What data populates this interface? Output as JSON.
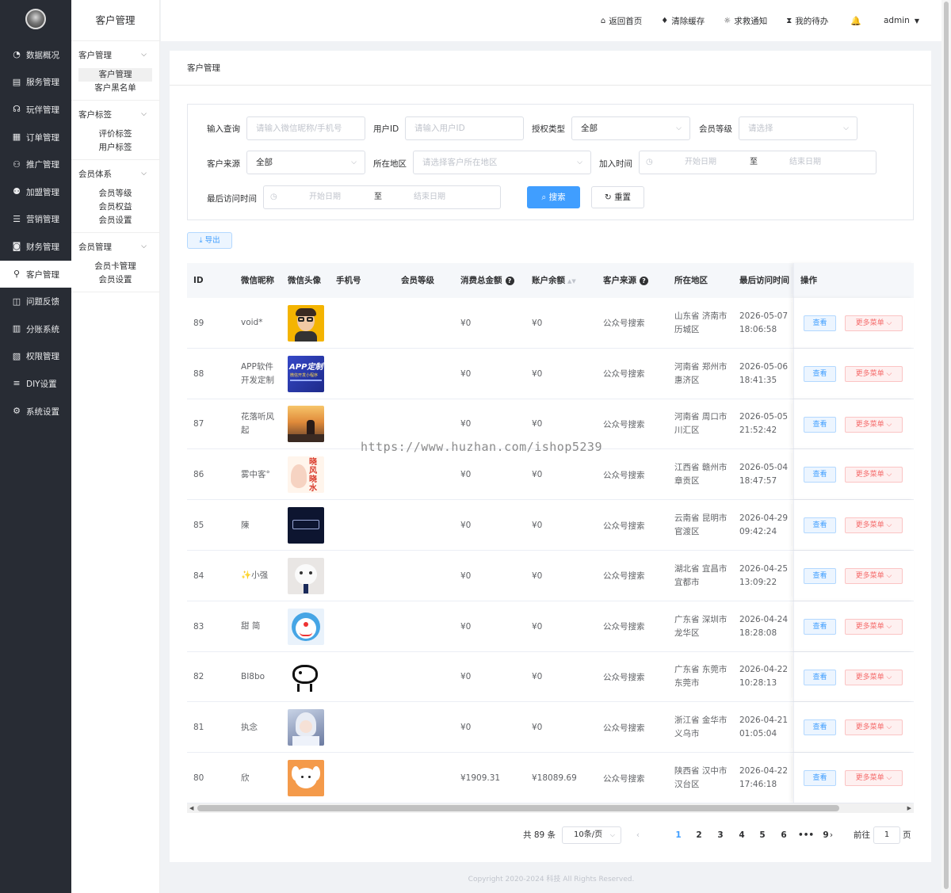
{
  "sidebar": {
    "items": [
      {
        "label": "数据概况",
        "icon": "dashboard-icon"
      },
      {
        "label": "服务管理",
        "icon": "service-icon"
      },
      {
        "label": "玩伴管理",
        "icon": "headset-icon"
      },
      {
        "label": "订单管理",
        "icon": "order-icon"
      },
      {
        "label": "推广管理",
        "icon": "promotion-icon"
      },
      {
        "label": "加盟管理",
        "icon": "franchise-icon"
      },
      {
        "label": "营销管理",
        "icon": "marketing-icon"
      },
      {
        "label": "财务管理",
        "icon": "finance-icon"
      },
      {
        "label": "客户管理",
        "icon": "customer-icon",
        "active": true
      },
      {
        "label": "问题反馈",
        "icon": "feedback-icon"
      },
      {
        "label": "分账系统",
        "icon": "split-icon"
      },
      {
        "label": "权限管理",
        "icon": "permission-icon"
      },
      {
        "label": "DIY设置",
        "icon": "diy-icon"
      },
      {
        "label": "系统设置",
        "icon": "settings-icon"
      }
    ]
  },
  "subsidebar": {
    "title": "客户管理",
    "groups": [
      {
        "label": "客户管理",
        "items": [
          "客户管理",
          "客户黑名单"
        ]
      },
      {
        "label": "客户标签",
        "items": [
          "评价标签",
          "用户标签"
        ]
      },
      {
        "label": "会员体系",
        "items": [
          "会员等级",
          "会员权益",
          "会员设置"
        ]
      },
      {
        "label": "会员管理",
        "items": [
          "会员卡管理",
          "会员设置"
        ]
      }
    ]
  },
  "topbar": {
    "home": "返回首页",
    "clear_cache": "清除缓存",
    "help": "求救通知",
    "todo": "我的待办",
    "user": "admin"
  },
  "page": {
    "title": "客户管理"
  },
  "filters": {
    "query_label": "输入查询",
    "query_placeholder": "请输入微信昵称/手机号",
    "uid_label": "用户ID",
    "uid_placeholder": "请输入用户ID",
    "auth_label": "授权类型",
    "auth_value": "全部",
    "level_label": "会员等级",
    "level_placeholder": "请选择",
    "source_label": "客户来源",
    "source_value": "全部",
    "region_label": "所在地区",
    "region_placeholder": "请选择客户所在地区",
    "join_label": "加入时间",
    "start_placeholder": "开始日期",
    "to": "至",
    "end_placeholder": "结束日期",
    "visit_label": "最后访问时间",
    "search": "搜索",
    "reset": "重置",
    "export": "导出"
  },
  "table": {
    "columns": {
      "id": "ID",
      "nickname": "微信昵称",
      "avatar": "微信头像",
      "phone": "手机号",
      "level": "会员等级",
      "spend": "消费总金额",
      "balance": "账户余额",
      "source": "客户来源",
      "region": "所在地区",
      "last_visit": "最后访问时间",
      "ops": "操作"
    },
    "view_label": "查看",
    "more_label": "更多菜单",
    "rows": [
      {
        "id": "89",
        "nickname": "void*",
        "spend": "¥0",
        "balance": "¥0",
        "source": "公众号搜索",
        "region1": "山东省 济南市",
        "region2": "历城区",
        "date": "2026-05-07",
        "time": "18:06:58",
        "avatar": "cartoon-glasses"
      },
      {
        "id": "88",
        "nickname": "APP软件",
        "nickname2": "开发定制",
        "spend": "¥0",
        "balance": "¥0",
        "source": "公众号搜索",
        "region1": "河南省 郑州市",
        "region2": "惠济区",
        "date": "2026-05-06",
        "time": "18:41:35",
        "avatar": "app-banner",
        "avatar_text": "APP定制",
        "avatar_sub": "微信开发小程序"
      },
      {
        "id": "87",
        "nickname": "花落听风",
        "nickname2": "起",
        "spend": "¥0",
        "balance": "¥0",
        "source": "公众号搜索",
        "region1": "河南省 周口市",
        "region2": "川汇区",
        "date": "2026-05-05",
        "time": "21:52:42",
        "avatar": "sunset"
      },
      {
        "id": "86",
        "nickname": "雾中客°",
        "spend": "¥0",
        "balance": "¥0",
        "source": "公众号搜索",
        "region1": "江西省 赣州市",
        "region2": "章贡区",
        "date": "2026-05-04",
        "time": "18:47:57",
        "avatar": "calligraphy"
      },
      {
        "id": "85",
        "nickname": "陳",
        "spend": "¥0",
        "balance": "¥0",
        "source": "公众号搜索",
        "region1": "云南省 昆明市",
        "region2": "官渡区",
        "date": "2026-04-29",
        "time": "09:42:24",
        "avatar": "dark-logo"
      },
      {
        "id": "84",
        "nickname": "✨小强",
        "spend": "¥0",
        "balance": "¥0",
        "source": "公众号搜索",
        "region1": "湖北省 宜昌市",
        "region2": "宜都市",
        "date": "2026-04-25",
        "time": "13:09:22",
        "avatar": "cat"
      },
      {
        "id": "83",
        "nickname": "甜 简",
        "spend": "¥0",
        "balance": "¥0",
        "source": "公众号搜索",
        "region1": "广东省 深圳市",
        "region2": "龙华区",
        "date": "2026-04-24",
        "time": "18:28:08",
        "avatar": "doraemon"
      },
      {
        "id": "82",
        "nickname": "BI8bo",
        "spend": "¥0",
        "balance": "¥0",
        "source": "公众号搜索",
        "region1": "广东省 东莞市",
        "region2": "东莞市",
        "date": "2026-04-22",
        "time": "10:28:13",
        "avatar": "sheep-sketch"
      },
      {
        "id": "81",
        "nickname": "执念",
        "spend": "¥0",
        "balance": "¥0",
        "source": "公众号搜索",
        "region1": "浙江省 金华市",
        "region2": "义乌市",
        "date": "2026-04-21",
        "time": "01:05:04",
        "avatar": "anime-girl"
      },
      {
        "id": "80",
        "nickname": "欣",
        "spend": "¥1909.31",
        "balance": "¥18089.69",
        "source": "公众号搜索",
        "region1": "陕西省 汉中市",
        "region2": "汉台区",
        "date": "2026-04-22",
        "time": "17:46:18",
        "avatar": "dog-cartoon"
      }
    ]
  },
  "pagination": {
    "total": "共 89 条",
    "page_size": "10条/页",
    "pages": [
      "1",
      "2",
      "3",
      "4",
      "5",
      "6",
      "•••",
      "9"
    ],
    "current": "1",
    "goto_label": "前往",
    "goto_value": "1",
    "goto_suffix": "页"
  },
  "footer": "Copyright 2020-2024 科技 All Rights Reserved.",
  "watermark": "https://www.huzhan.com/ishop5239"
}
